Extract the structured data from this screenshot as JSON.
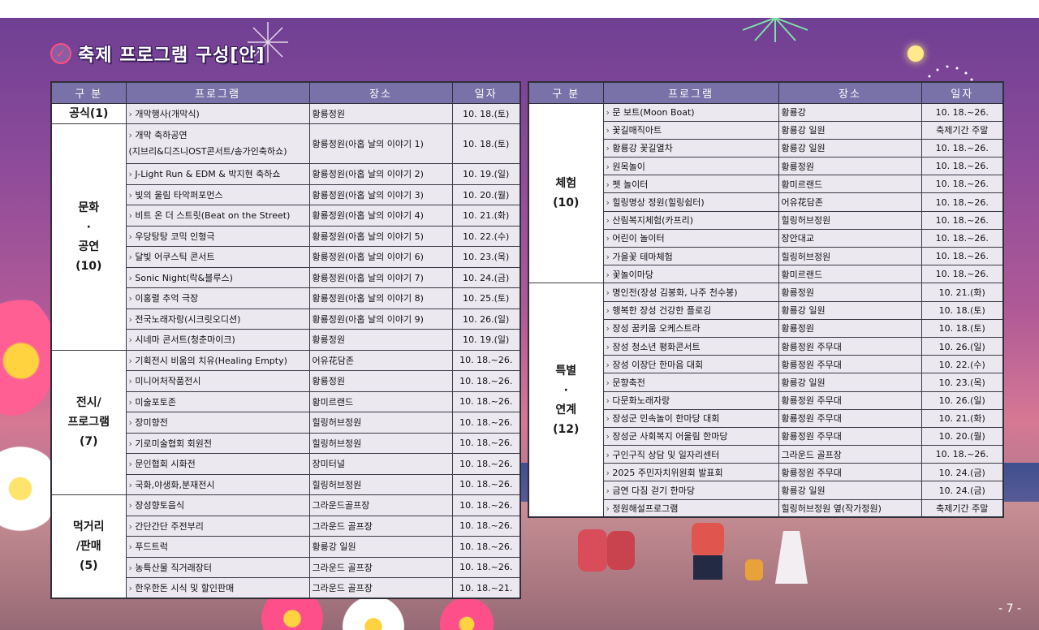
{
  "title": "축제 프로그램 구성[안]",
  "page_number": "- 7 -",
  "headers": {
    "category": "구 분",
    "program": "프로그램",
    "venue": "장소",
    "date": "일자"
  },
  "colors": {
    "header_bg": "#7872a8",
    "cell_bg": "#ebe8ef",
    "title_check": "#ff4f7b"
  },
  "left_table": {
    "groups": [
      {
        "category": "공식(1)",
        "rows": [
          {
            "program": "개막행사(개막식)",
            "venue": "황룡정원",
            "date": "10. 18.(토)"
          }
        ]
      },
      {
        "category": "문화\n·\n공연\n(10)",
        "rows": [
          {
            "program": "개막 축하공연\n(지브리&디즈니OST콘서트/송가인축하쇼)",
            "venue": "황룡정원(아홉 날의 이야기 1)",
            "date": "10. 18.(토)"
          },
          {
            "program": "J-Light Run & EDM & 박지현 축하쇼",
            "venue": "황룡정원(아홉 날의 이야기 2)",
            "date": "10. 19.(일)"
          },
          {
            "program": "빛의 울림 타악퍼포먼스",
            "venue": "황룡정원(아홉 날의 이야기 3)",
            "date": "10. 20.(월)"
          },
          {
            "program": "비트 온 더 스트릿(Beat on the Street)",
            "venue": "황룡정원(아홉 날의 이야기 4)",
            "date": "10. 21.(화)"
          },
          {
            "program": "우당탕탕 코믹 인형극",
            "venue": "황룡정원(아홉 날의 이야기 5)",
            "date": "10. 22.(수)"
          },
          {
            "program": "달빛 어쿠스틱 콘서트",
            "venue": "황룡정원(아홉 날의 이야기 6)",
            "date": "10. 23.(목)"
          },
          {
            "program": "Sonic Night(락&블루스)",
            "venue": "황룡정원(아홉 날의 이야기 7)",
            "date": "10. 24.(금)"
          },
          {
            "program": "이홍렬 추억 극장",
            "venue": "황룡정원(아홉 날의 이야기 8)",
            "date": "10. 25.(토)"
          },
          {
            "program": "전국노래자랑(시크릿오디션)",
            "venue": "황룡정원(아홉 날의 이야기 9)",
            "date": "10. 26.(일)"
          },
          {
            "program": "시네마 콘서트(청춘마이크)",
            "venue": "황룡정원",
            "date": "10. 19.(일)"
          }
        ]
      },
      {
        "category": "전시/\n프로그램\n(7)",
        "rows": [
          {
            "program": "기획전시 비움의 치유(Healing Empty)",
            "venue": "어유花담존",
            "date": "10. 18.~26."
          },
          {
            "program": "미니어처작품전시",
            "venue": "황룡정원",
            "date": "10. 18.~26."
          },
          {
            "program": "미술포토존",
            "venue": "황미르랜드",
            "date": "10. 18.~26."
          },
          {
            "program": "장미향전",
            "venue": "힐링허브정원",
            "date": "10. 18.~26."
          },
          {
            "program": "기로미술협회 회원전",
            "venue": "힐링허브정원",
            "date": "10. 18.~26."
          },
          {
            "program": "문인협회 시화전",
            "venue": "장미터널",
            "date": "10. 18.~26."
          },
          {
            "program": "국화,야생화,분재전시",
            "venue": "힐링허브정원",
            "date": "10. 18.~26."
          }
        ]
      },
      {
        "category": "먹거리\n/판매\n(5)",
        "rows": [
          {
            "program": "장성향토음식",
            "venue": "그라운드골프장",
            "date": "10. 18.~26."
          },
          {
            "program": "간단간단 주전부리",
            "venue": "그라운드 골프장",
            "date": "10. 18.~26."
          },
          {
            "program": "푸드트럭",
            "venue": "황룡강 일원",
            "date": "10. 18.~26."
          },
          {
            "program": "농특산물 직거래장터",
            "venue": "그라운드 골프장",
            "date": "10. 18.~26."
          },
          {
            "program": "한우한돈 시식 및 할인판매",
            "venue": "그라운드 골프장",
            "date": "10. 18.~21."
          }
        ]
      }
    ]
  },
  "right_table": {
    "groups": [
      {
        "category": "체험\n(10)",
        "rows": [
          {
            "program": "문 보트(Moon Boat)",
            "venue": "황룡강",
            "date": "10. 18.~26."
          },
          {
            "program": "꽃길매직아트",
            "venue": "황룡강 일원",
            "date": "축제기간 주말"
          },
          {
            "program": "황룡강 꽃길열차",
            "venue": "황룡강 일원",
            "date": "10. 18.~26."
          },
          {
            "program": "원목놀이",
            "venue": "황룡정원",
            "date": "10. 18.~26."
          },
          {
            "program": "펫 놀이터",
            "venue": "황미르랜드",
            "date": "10. 18.~26."
          },
          {
            "program": "힐링명상 정원(힐링쉼터)",
            "venue": "어유花담존",
            "date": "10. 18.~26."
          },
          {
            "program": "산림복지체험(카프리)",
            "venue": "힐링허브정원",
            "date": "10. 18.~26."
          },
          {
            "program": "어린이 놀이터",
            "venue": "장안대교",
            "date": "10. 18.~26."
          },
          {
            "program": "가을꽃 테마체험",
            "venue": "힐링허브정원",
            "date": "10. 18.~26."
          },
          {
            "program": "꽃놀이마당",
            "venue": "황미르랜드",
            "date": "10. 18.~26."
          }
        ]
      },
      {
        "category": "특별\n·\n연계\n(12)",
        "rows": [
          {
            "program": "명인전(장성 김봉화, 나주 천수봉)",
            "venue": "황룡정원",
            "date": "10. 21.(화)"
          },
          {
            "program": "행복한 장성 건강한 플로깅",
            "venue": "황룡강 일원",
            "date": "10. 18.(토)"
          },
          {
            "program": "장성 꿈키움 오케스트라",
            "venue": "황룡정원",
            "date": "10. 18.(토)"
          },
          {
            "program": "장성 청소년 평화콘서트",
            "venue": "황룡정원 주무대",
            "date": "10. 26.(일)"
          },
          {
            "program": "장성 이장단 한마음 대회",
            "venue": "황룡정원 주무대",
            "date": "10. 22.(수)"
          },
          {
            "program": "문향축전",
            "venue": "황룡강 일원",
            "date": "10. 23.(목)"
          },
          {
            "program": "다문화노래자랑",
            "venue": "황룡정원 주무대",
            "date": "10. 26.(일)"
          },
          {
            "program": "장성군 민속놀이 한마당 대회",
            "venue": "황룡정원 주무대",
            "date": "10. 21.(화)"
          },
          {
            "program": "장성군 사회복지 어울림 한마당",
            "venue": "황룡정원 주무대",
            "date": "10. 20.(월)"
          },
          {
            "program": "구인구직 상담 및 일자리센터",
            "venue": "그라운드 골프장",
            "date": "10. 18.~26."
          },
          {
            "program": "2025 주민자치위원회 발표회",
            "venue": "황룡정원 주무대",
            "date": "10. 24.(금)"
          },
          {
            "program": "금연 다짐 걷기 한마당",
            "venue": "황룡강 일원",
            "date": "10. 24.(금)"
          },
          {
            "program": "정원해설프로그램",
            "venue": "힐링허브정원 옆(작가정원)",
            "date": "축제기간 주말"
          }
        ]
      }
    ]
  }
}
